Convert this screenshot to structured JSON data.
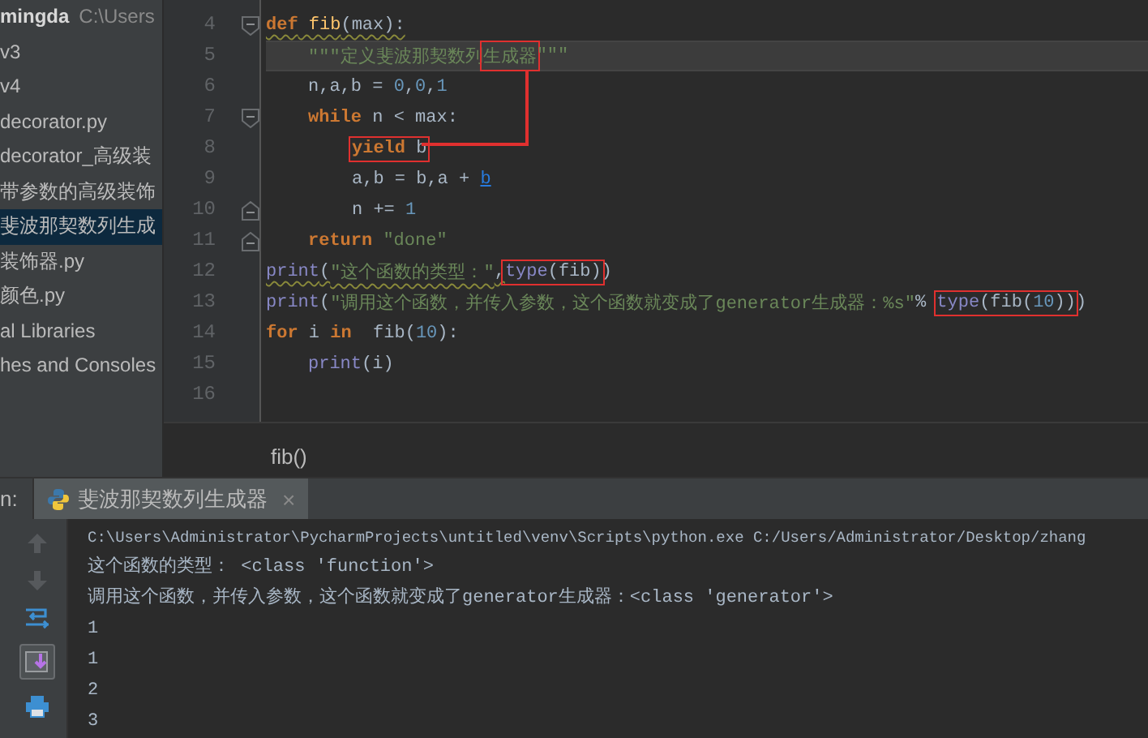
{
  "project": {
    "root": {
      "name": "mingda",
      "path": "C:\\Users"
    },
    "items": [
      {
        "label": "v3",
        "selected": false
      },
      {
        "label": "v4",
        "selected": false
      },
      {
        "label": "decorator.py",
        "selected": false
      },
      {
        "label": "decorator_高级装",
        "selected": false
      },
      {
        "label": "带参数的高级装饰",
        "selected": false
      },
      {
        "label": "斐波那契数列生成",
        "selected": true
      },
      {
        "label": "装饰器.py",
        "selected": false
      },
      {
        "label": "颜色.py",
        "selected": false
      },
      {
        "label": "al Libraries",
        "selected": false
      },
      {
        "label": "hes and Consoles",
        "selected": false
      }
    ]
  },
  "editor": {
    "lines": [
      {
        "number": "4",
        "kind": "top",
        "fold_start": true,
        "fold_end": false,
        "current": false,
        "segments": [
          {
            "kind": "keyword",
            "text": "def",
            "squiggle": true
          },
          {
            "kind": "funcname",
            "text": " fib",
            "squiggle": true
          },
          {
            "kind": "plain",
            "text": "(max):",
            "squiggle": true
          }
        ]
      },
      {
        "number": "5",
        "kind": "body",
        "fold_start": false,
        "fold_end": false,
        "current": true,
        "segments": [
          {
            "kind": "string",
            "text": "\"\"\"定义斐波那契数列"
          },
          {
            "kind": "box",
            "tokens": [
              {
                "kind": "string",
                "text": "生成器"
              }
            ]
          },
          {
            "kind": "string",
            "text": "\"\"\""
          }
        ]
      },
      {
        "number": "6",
        "kind": "body",
        "fold_start": false,
        "fold_end": false,
        "current": false,
        "segments": [
          {
            "kind": "plain",
            "text": "n,a,b = "
          },
          {
            "kind": "number",
            "text": "0"
          },
          {
            "kind": "plain",
            "text": ","
          },
          {
            "kind": "number",
            "text": "0"
          },
          {
            "kind": "plain",
            "text": ","
          },
          {
            "kind": "number",
            "text": "1"
          }
        ]
      },
      {
        "number": "7",
        "kind": "body",
        "fold_start": true,
        "fold_end": false,
        "current": false,
        "segments": [
          {
            "kind": "keyword",
            "text": "while"
          },
          {
            "kind": "plain",
            "text": " n < max:"
          }
        ]
      },
      {
        "number": "8",
        "kind": "nested",
        "fold_start": false,
        "fold_end": false,
        "current": false,
        "segments": [
          {
            "kind": "box",
            "tokens": [
              {
                "kind": "keyword",
                "text": "yield"
              },
              {
                "kind": "plain",
                "text": " b"
              }
            ]
          }
        ]
      },
      {
        "number": "9",
        "kind": "nested",
        "fold_start": false,
        "fold_end": false,
        "current": false,
        "segments": [
          {
            "kind": "plain",
            "text": "a,b = b,a + "
          },
          {
            "kind": "link",
            "text": "b"
          }
        ]
      },
      {
        "number": "10",
        "kind": "nested",
        "fold_start": false,
        "fold_end": true,
        "current": false,
        "segments": [
          {
            "kind": "plain",
            "text": "n += "
          },
          {
            "kind": "number",
            "text": "1"
          }
        ]
      },
      {
        "number": "11",
        "kind": "body",
        "fold_start": false,
        "fold_end": true,
        "current": false,
        "segments": [
          {
            "kind": "keyword",
            "text": "return"
          },
          {
            "kind": "string",
            "text": " \"done\""
          }
        ]
      },
      {
        "number": "12",
        "kind": "top",
        "fold_start": false,
        "fold_end": false,
        "current": false,
        "segments": [
          {
            "kind": "builtin",
            "text": "print",
            "squiggle": true
          },
          {
            "kind": "plain",
            "text": "(",
            "squiggle": true
          },
          {
            "kind": "string",
            "text": "\"这个函数的类型：\"",
            "squiggle": true
          },
          {
            "kind": "plain",
            "text": ",",
            "squiggle": true
          },
          {
            "kind": "box",
            "tokens": [
              {
                "kind": "builtin",
                "text": "type"
              },
              {
                "kind": "plain",
                "text": "(fib)"
              }
            ]
          },
          {
            "kind": "plain",
            "text": ")"
          }
        ]
      },
      {
        "number": "13",
        "kind": "top",
        "fold_start": false,
        "fold_end": false,
        "current": false,
        "segments": [
          {
            "kind": "builtin",
            "text": "print"
          },
          {
            "kind": "plain",
            "text": "("
          },
          {
            "kind": "string",
            "text": "\"调用这个函数，并传入参数，这个函数就变成了generator生成器：%s\""
          },
          {
            "kind": "plain",
            "text": "% "
          },
          {
            "kind": "box",
            "tokens": [
              {
                "kind": "builtin",
                "text": "type"
              },
              {
                "kind": "plain",
                "text": "(fib("
              },
              {
                "kind": "number",
                "text": "10"
              },
              {
                "kind": "plain",
                "text": "))"
              }
            ]
          },
          {
            "kind": "plain",
            "text": ")"
          }
        ]
      },
      {
        "number": "14",
        "kind": "top",
        "fold_start": false,
        "fold_end": false,
        "current": false,
        "segments": [
          {
            "kind": "keyword",
            "text": "for"
          },
          {
            "kind": "plain",
            "text": " i "
          },
          {
            "kind": "keyword",
            "text": "in"
          },
          {
            "kind": "plain",
            "text": "  fib("
          },
          {
            "kind": "number",
            "text": "10"
          },
          {
            "kind": "plain",
            "text": "):"
          }
        ]
      },
      {
        "number": "15",
        "kind": "body",
        "fold_start": false,
        "fold_end": false,
        "current": false,
        "segments": [
          {
            "kind": "builtin",
            "text": "print"
          },
          {
            "kind": "plain",
            "text": "(i)"
          }
        ]
      },
      {
        "number": "16",
        "kind": "top",
        "fold_start": false,
        "fold_end": false,
        "current": false
      }
    ],
    "breadcrumb": "fib()"
  },
  "run": {
    "label": "n:",
    "tabs": [
      {
        "label": "斐波那契数列生成器",
        "selected": true,
        "close": "×"
      }
    ],
    "output": [
      {
        "kind": "command",
        "text": "C:\\Users\\Administrator\\PycharmProjects\\untitled\\venv\\Scripts\\python.exe C:/Users/Administrator/Desktop/zhang"
      },
      {
        "kind": "text",
        "text": "这个函数的类型： <class 'function'>"
      },
      {
        "kind": "text",
        "text": "调用这个函数，并传入参数，这个函数就变成了generator生成器：<class 'generator'>"
      },
      {
        "kind": "text",
        "text": "1"
      },
      {
        "kind": "text",
        "text": "1"
      },
      {
        "kind": "text",
        "text": "2"
      },
      {
        "kind": "text",
        "text": "3"
      }
    ]
  }
}
